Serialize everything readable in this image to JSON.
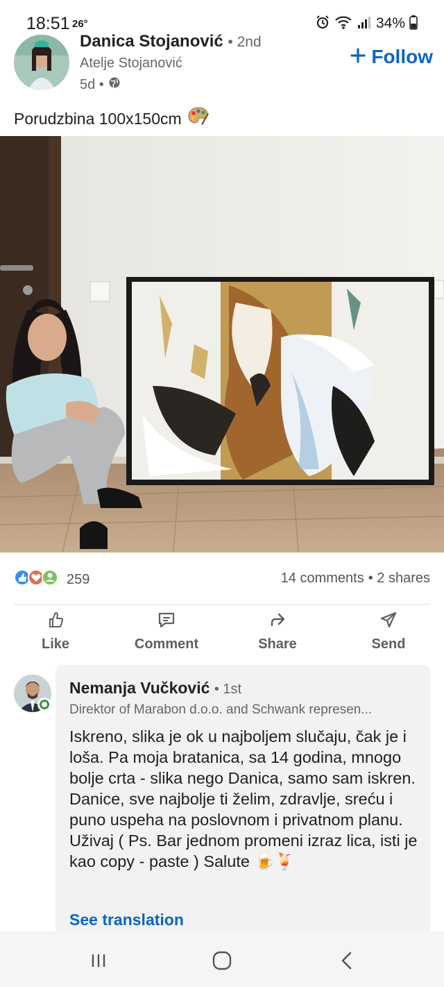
{
  "status_bar": {
    "time": "18:51",
    "temperature": "26°",
    "battery": "34%",
    "icons": [
      "alarm-icon",
      "wifi-icon",
      "signal-icon",
      "battery-icon"
    ]
  },
  "post": {
    "author_name": "Danica Stojanović",
    "author_degree": "• 2nd",
    "author_company": "Atelje Stojanović",
    "age": "5d •",
    "follow_label": "Follow",
    "text": "Porudzbina 100x150cm",
    "reaction_count": "259",
    "comments_count": "14 comments",
    "shares_count": "• 2 shares"
  },
  "actions": [
    {
      "label": "Like",
      "icon": "like-icon"
    },
    {
      "label": "Comment",
      "icon": "comment-icon"
    },
    {
      "label": "Share",
      "icon": "share-icon"
    },
    {
      "label": "Send",
      "icon": "send-icon"
    }
  ],
  "comment": {
    "author_name": "Nemanja Vučković",
    "degree": "• 1st",
    "headline": "Direktor of Marabon d.o.o. and Schwank represen...",
    "body": "Iskreno, slika je ok u najboljem slučaju, čak je i loša. Pa moja bratanica, sa 14 godina, mnogo bolje crta - slika nego Danica, samo sam iskren. Danice, sve najbolje ti želim, zdravlje, sreću i puno uspeha na poslovnom i privatnom planu. Uživaj ( Ps. Bar jednom promeni izraz lica, isti je kao copy - paste ) Salute",
    "emoji": "🍺🍹",
    "translate_label": "See translation"
  },
  "colors": {
    "accent": "#0a66c2",
    "online": "#3d8f3a"
  }
}
